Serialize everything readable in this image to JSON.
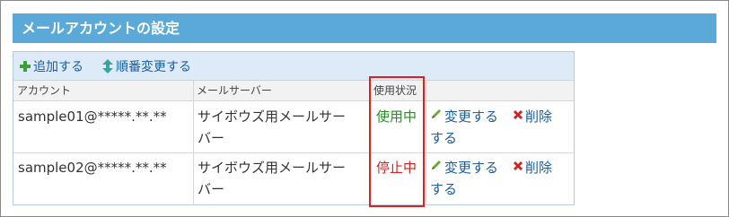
{
  "header": {
    "title": "メールアカウントの設定"
  },
  "toolbar": {
    "add_label": "追加する",
    "order_label": "順番変更する"
  },
  "table": {
    "columns": [
      "アカウント",
      "メールサーバー",
      "使用状況"
    ],
    "rows": [
      {
        "account": "sample01@*****.**.**",
        "server_line1": "サイボウズ用メールサー",
        "server_line2": "バー",
        "status": "使用中",
        "change_line1": "変更する",
        "delete_line1": "削除",
        "delete_line2": "する"
      },
      {
        "account": "sample02@*****.**.**",
        "server_line1": "サイボウズ用メールサー",
        "server_line2": "バー",
        "status": "停止中",
        "change_line1": "変更する",
        "delete_line1": "削除",
        "delete_line2": "する"
      }
    ]
  },
  "colors": {
    "header_bg": "#5ba9d8",
    "status_active": "#2a8a2a",
    "status_stopped": "#d22020",
    "link": "#1c5c9f",
    "highlight": "#e02020"
  },
  "icons": {
    "add": "plus-icon",
    "order": "up-down-arrow-icon",
    "change": "pencil-icon",
    "delete": "x-icon"
  }
}
